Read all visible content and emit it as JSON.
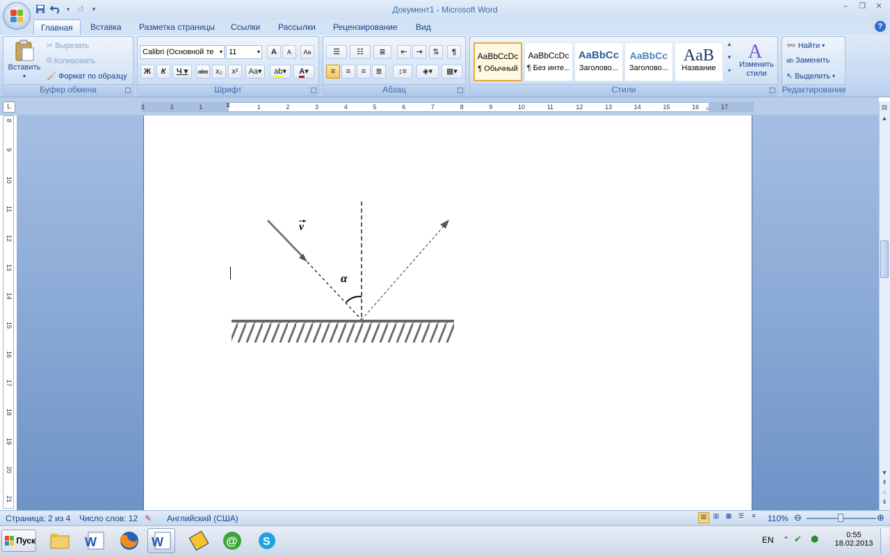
{
  "window": {
    "title": "Документ1 - Microsoft Word",
    "controls": [
      "–",
      "❐",
      "✕"
    ]
  },
  "tabs": [
    "Главная",
    "Вставка",
    "Разметка страницы",
    "Ссылки",
    "Рассылки",
    "Рецензирование",
    "Вид"
  ],
  "clipboard": {
    "paste": "Вставить",
    "cut": "Вырезать",
    "copy": "Копировать",
    "format_painter": "Формат по образцу",
    "label": "Буфер обмена"
  },
  "font": {
    "family": "Calibri (Основной те",
    "size": "11",
    "bold": "Ж",
    "italic": "К",
    "underline": "Ч",
    "strike": "abc",
    "sub": "x₂",
    "sup": "x²",
    "case": "Aa",
    "grow": "A",
    "shrink": "A",
    "color_letter": "A",
    "label": "Шрифт"
  },
  "paragraph": {
    "label": "Абзац",
    "pilcrow": "¶"
  },
  "styles": {
    "label": "Стили",
    "items": [
      {
        "sample": "AaBbCcDc",
        "name": "¶ Обычный"
      },
      {
        "sample": "AaBbCcDc",
        "name": "¶ Без инте..."
      },
      {
        "sample": "AaBbCc",
        "name": "Заголово..."
      },
      {
        "sample": "AaBbCc",
        "name": "Заголово..."
      },
      {
        "sample": "AaB",
        "name": "Название"
      }
    ],
    "change_styles": "Изменить стили"
  },
  "editing": {
    "label": "Редактирование",
    "find": "Найти",
    "replace": "Заменить",
    "select": "Выделить"
  },
  "ruler": {
    "corner": "L",
    "h_ticks": [
      "3",
      "2",
      "1",
      "1",
      "2",
      "3",
      "4",
      "5",
      "6",
      "7",
      "8",
      "9",
      "10",
      "11",
      "12",
      "13",
      "14",
      "15",
      "16",
      "17"
    ],
    "v_ticks": [
      "8",
      "9",
      "10",
      "11",
      "12",
      "13",
      "14",
      "15",
      "16",
      "17",
      "18",
      "19",
      "20",
      "21"
    ]
  },
  "document": {
    "vector_label": "v",
    "angle_label": "α"
  },
  "status": {
    "page": "Страница: 2 из 4",
    "words": "Число слов: 12",
    "language": "Английский (США)",
    "zoom": "110%"
  },
  "taskbar": {
    "start": "Пуск",
    "lang": "EN",
    "time": "0:55",
    "date": "18.02.2013"
  },
  "colors": {
    "accent": "#15428b",
    "ribbon_bg": "#c5d9f1",
    "workspace": "#8aa9d6",
    "font_color_bar": "#e00000"
  }
}
